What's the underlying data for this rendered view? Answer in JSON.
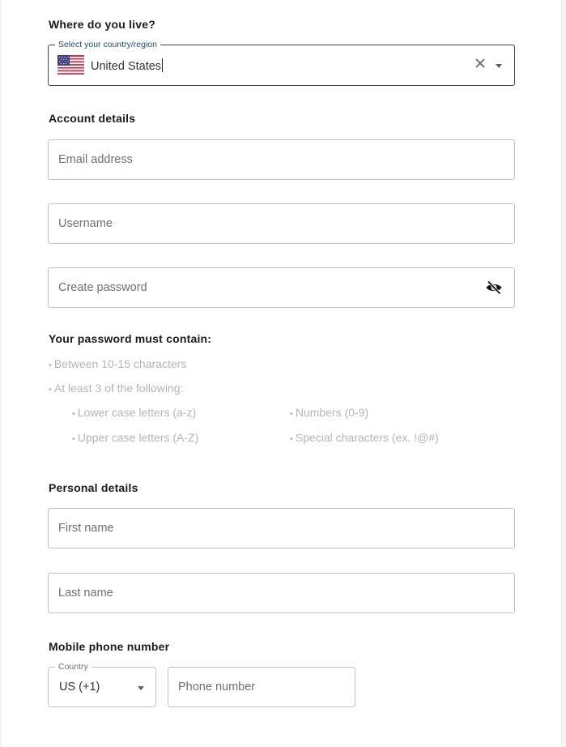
{
  "location": {
    "heading": "Where do you live?",
    "country_legend": "Select your country/region",
    "country_value": "United States",
    "flag_icon": "us-flag-icon",
    "clear_icon": "close-icon",
    "dropdown_icon": "chevron-down-icon"
  },
  "account": {
    "heading": "Account details",
    "email_placeholder": "Email address",
    "username_placeholder": "Username",
    "password_placeholder": "Create password",
    "password_toggle_icon": "eye-off-icon"
  },
  "password_rules": {
    "heading": "Your password must contain:",
    "bullet": "•",
    "rules": [
      "Between 10-15 characters",
      "At least 3 of the following:"
    ],
    "sub_rules": [
      "Lower case letters (a-z)",
      "Numbers (0-9)",
      "Upper case letters (A-Z)",
      "Special characters (ex. !@#)"
    ]
  },
  "personal": {
    "heading": "Personal details",
    "first_name_placeholder": "First name",
    "last_name_placeholder": "Last name"
  },
  "phone": {
    "heading": "Mobile phone number",
    "country_legend": "Country",
    "country_value": "US (+1)",
    "number_placeholder": "Phone number"
  },
  "colors": {
    "focus_border": "#1a4a7a",
    "field_border": "#c2c2c2",
    "muted_text": "#b4b4b4",
    "placeholder_text": "#6f6f6f"
  }
}
